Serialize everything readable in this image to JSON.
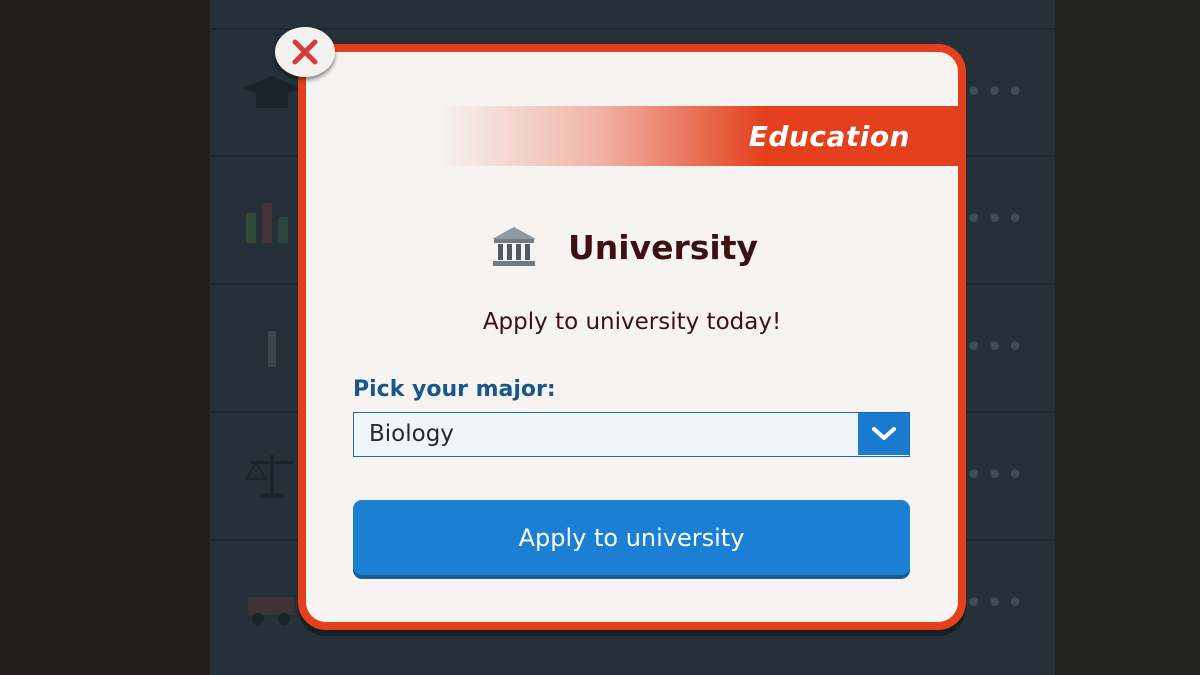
{
  "background_list": {
    "rows": [
      {
        "icon": "graduation-cap-icon"
      },
      {
        "icon": "bar-chart-icon"
      },
      {
        "icon": "pencil-icon"
      },
      {
        "icon": "scales-icon"
      },
      {
        "icon": "vehicle-icon"
      }
    ]
  },
  "dialog": {
    "close_icon": "close-icon",
    "section": "Education",
    "title_icon": "university-building-icon",
    "title": "University",
    "message": "Apply to university today!",
    "major": {
      "label": "Pick your major:",
      "selected": "Biology",
      "arrow_icon": "chevron-down-icon"
    },
    "apply_button": "Apply to university"
  },
  "colors": {
    "accent_red": "#e4401d",
    "primary_blue": "#1b7fd4",
    "title_text": "#3d1014",
    "label_blue": "#19568a"
  }
}
